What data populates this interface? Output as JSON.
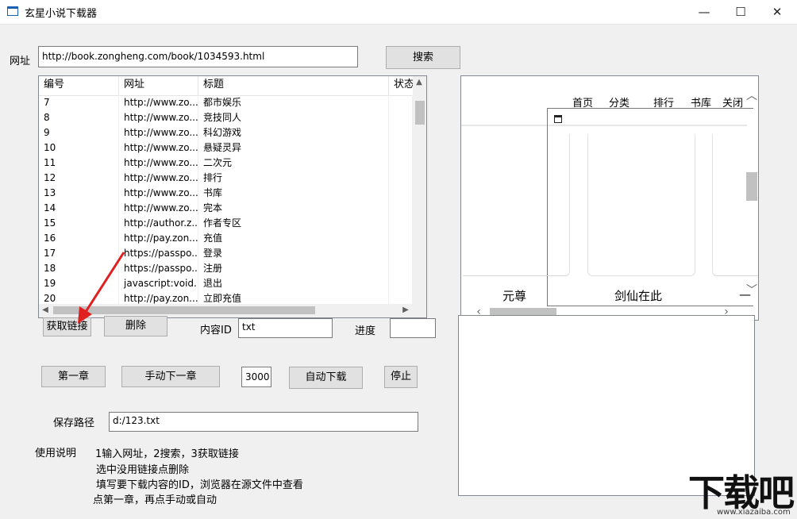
{
  "window": {
    "title": "玄星小说下载器",
    "controls": {
      "minimize": "—",
      "maximize": "☐",
      "close": "✕"
    }
  },
  "url_row": {
    "label": "网址",
    "value": "http://book.zongheng.com/book/1034593.html",
    "search_button": "搜索"
  },
  "table": {
    "columns": [
      "编号",
      "网址",
      "标题",
      "状态"
    ],
    "rows": [
      {
        "id": "7",
        "url": "http://www.zo...",
        "title": "都市娱乐"
      },
      {
        "id": "8",
        "url": "http://www.zo...",
        "title": "竞技同人"
      },
      {
        "id": "9",
        "url": "http://www.zo...",
        "title": "科幻游戏"
      },
      {
        "id": "10",
        "url": "http://www.zo...",
        "title": "悬疑灵异"
      },
      {
        "id": "11",
        "url": "http://www.zo...",
        "title": "二次元"
      },
      {
        "id": "12",
        "url": "http://www.zo...",
        "title": "排行"
      },
      {
        "id": "13",
        "url": "http://www.zo...",
        "title": "书库"
      },
      {
        "id": "14",
        "url": "http://www.zo...",
        "title": "完本"
      },
      {
        "id": "15",
        "url": "http://author.z...",
        "title": "作者专区"
      },
      {
        "id": "16",
        "url": "http://pay.zon...",
        "title": "充值"
      },
      {
        "id": "17",
        "url": "https://passpo...",
        "title": "登录"
      },
      {
        "id": "18",
        "url": "https://passpo...",
        "title": "注册"
      },
      {
        "id": "19",
        "url": "javascript:void...",
        "title": "退出"
      },
      {
        "id": "20",
        "url": "http://pay.zon...",
        "title": "立即充值"
      }
    ]
  },
  "actions": {
    "get_links": "获取链接",
    "delete": "删除",
    "content_id_label": "内容ID",
    "content_id_value": "txt",
    "progress_label": "进度",
    "progress_value": ""
  },
  "download": {
    "first_chapter": "第一章",
    "manual_next": "手动下一章",
    "interval": "3000",
    "auto_download": "自动下载",
    "stop": "停止"
  },
  "save": {
    "label": "保存路径",
    "value": "d:/123.txt"
  },
  "instructions": {
    "label": "使用说明",
    "lines": [
      "1输入网址，2搜索，3获取链接",
      "选中没用链接点删除",
      "填写要下载内容的ID，浏览器在源文件中查看",
      "点第一章，再点手动或自动"
    ]
  },
  "browser": {
    "nav": [
      "首页",
      "分类",
      "排行",
      "书库",
      "关闭"
    ],
    "books": [
      "元尊",
      "剑仙在此",
      "—"
    ]
  },
  "watermark": {
    "logo": "下载吧",
    "url": "www.xiazaiba.com"
  },
  "colors": {
    "window_bg": "#f0f0f0",
    "button_bg": "#e1e1e1",
    "annotation_arrow": "#e02020"
  }
}
